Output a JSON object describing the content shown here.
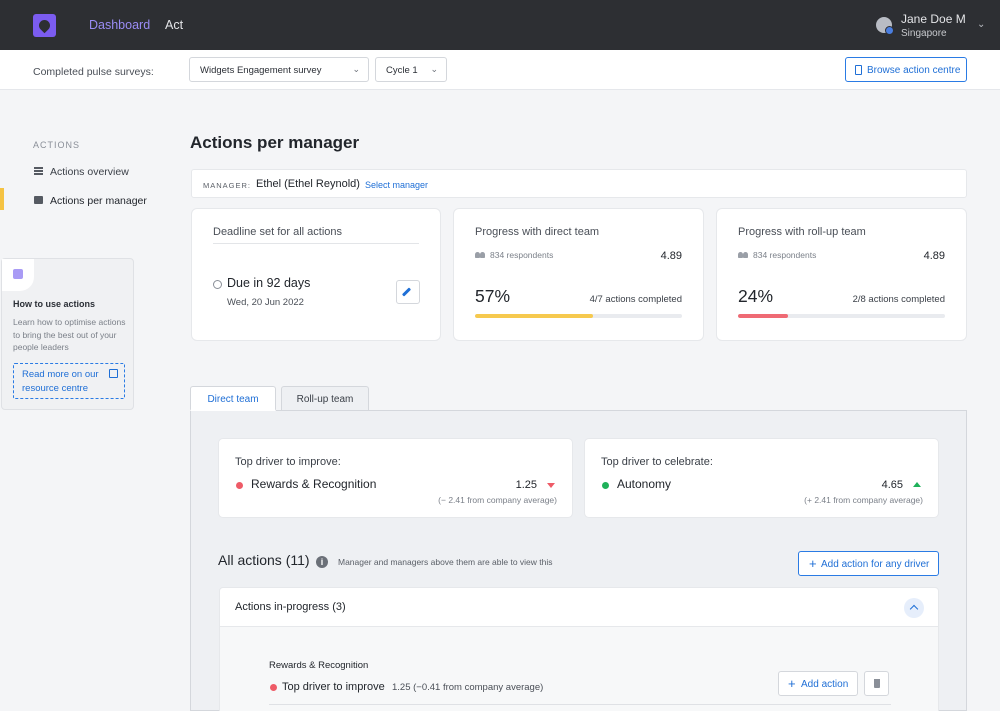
{
  "nav": {
    "dashboard": "Dashboard",
    "act": "Act",
    "user_name": "Jane Doe M",
    "user_location": "Singapore"
  },
  "filters": {
    "label": "Completed pulse surveys:",
    "survey": "Widgets Engagement survey",
    "cycle": "Cycle 1",
    "browse_button": "Browse action centre"
  },
  "sidebar": {
    "heading": "ACTIONS",
    "items": [
      {
        "label": "Actions overview",
        "active": false
      },
      {
        "label": "Actions per manager",
        "active": true
      }
    ],
    "help": {
      "title": "How to use actions",
      "text": "Learn how to optimise actions to bring the best out of your people leaders",
      "link": "Read more on our resource centre"
    }
  },
  "main": {
    "title": "Actions per manager",
    "manager_label": "MANAGER:",
    "manager_name": "Ethel (Ethel Reynold)",
    "select_manager": "Select manager"
  },
  "kpis": {
    "deadline": {
      "title": "Deadline set for all actions",
      "due": "Due in 92 days",
      "date": "Wed, 20 Jun 2022"
    },
    "direct": {
      "title": "Progress with direct team",
      "respondents": "834 respondents",
      "score": "4.89",
      "percent_text": "57%",
      "progress": 0.57,
      "completed": "4/7 actions completed"
    },
    "rollup": {
      "title": "Progress with roll-up team",
      "respondents": "834 respondents",
      "score": "4.89",
      "percent_text": "24%",
      "progress": 0.24,
      "completed": "2/8 actions completed"
    }
  },
  "tabs": [
    {
      "label": "Direct team",
      "active": true
    },
    {
      "label": "Roll-up team",
      "active": false
    }
  ],
  "drivers": {
    "improve": {
      "title": "Top driver to improve:",
      "name": "Rewards & Recognition",
      "score": "1.25",
      "note": "(− 2.41 from company average)",
      "trend": "down"
    },
    "celebrate": {
      "title": "Top driver to celebrate:",
      "name": "Autonomy",
      "score": "4.65",
      "note": "(+ 2.41 from company average)",
      "trend": "up"
    }
  },
  "actions": {
    "title": "All actions (11)",
    "note": "Manager and managers above them are able to view this",
    "add_any": "Add action for any driver",
    "in_progress_title": "Actions in-progress (3)",
    "group": {
      "driver": "Rewards & Recognition",
      "label": "Top driver to improve",
      "score_text": "1.25  (−0.41 from company average)",
      "add_action": "Add action"
    }
  },
  "colors": {
    "accent": "#1f6fd6",
    "nav_active": "#9a8cf5",
    "progress_direct": "#f6c94e",
    "progress_rollup": "#ef6a74",
    "negative": "#ee5b67",
    "positive": "#1fb15a",
    "sidebar_marker": "#f5c343"
  }
}
